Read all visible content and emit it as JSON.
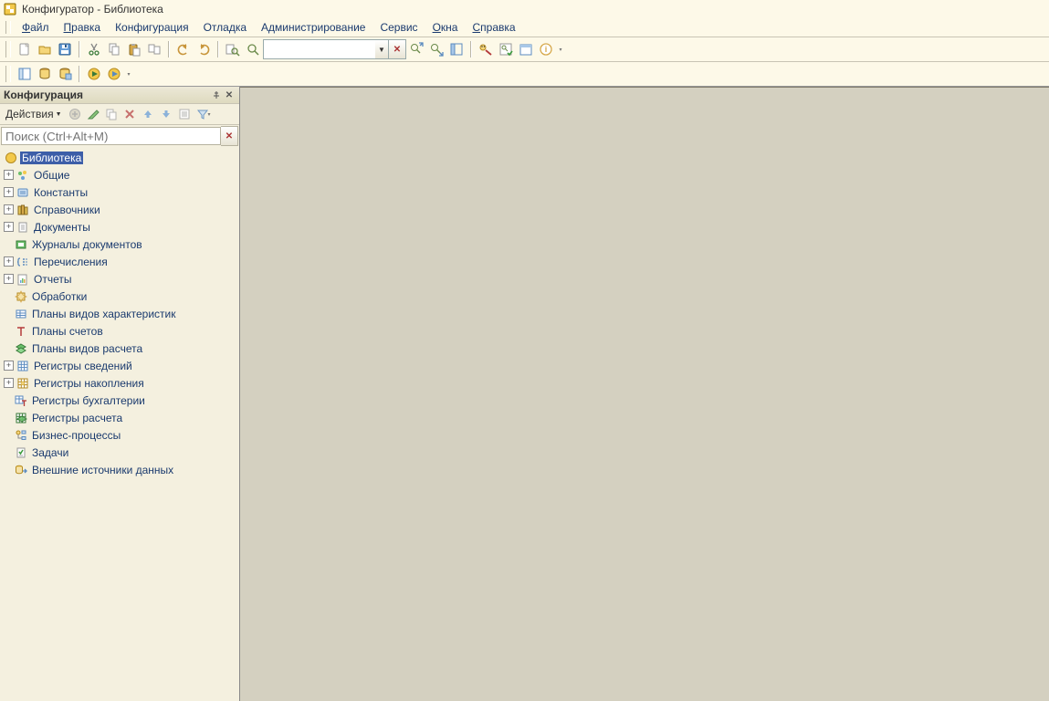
{
  "window": {
    "title": "Конфигуратор - Библиотека"
  },
  "menu": {
    "file": {
      "label": "Файл",
      "u": 0
    },
    "edit": {
      "label": "Правка",
      "u": 0
    },
    "config": {
      "label": "Конфигурация",
      "u": -1
    },
    "debug": {
      "label": "Отладка",
      "u": -1
    },
    "admin": {
      "label": "Администрирование",
      "u": -1
    },
    "service": {
      "label": "Сервис",
      "u": -1
    },
    "windows": {
      "label": "Окна",
      "u": 0
    },
    "help": {
      "label": "Справка",
      "u": 0
    }
  },
  "toolbar": {
    "searchValue": ""
  },
  "panel": {
    "title": "Конфигурация",
    "actionsLabel": "Действия",
    "searchPlaceholder": "Поиск (Ctrl+Alt+M)"
  },
  "tree": [
    {
      "id": "root",
      "label": "Библиотека",
      "icon": "circle-yellow",
      "expandable": false,
      "depth": 0,
      "selected": true
    },
    {
      "id": "common",
      "label": "Общие",
      "icon": "dots",
      "expandable": true,
      "depth": 1
    },
    {
      "id": "constants",
      "label": "Константы",
      "icon": "card-blue",
      "expandable": true,
      "depth": 1
    },
    {
      "id": "catalogs",
      "label": "Справочники",
      "icon": "books",
      "expandable": true,
      "depth": 1
    },
    {
      "id": "documents",
      "label": "Документы",
      "icon": "doc",
      "expandable": true,
      "depth": 1
    },
    {
      "id": "journals",
      "label": "Журналы документов",
      "icon": "journal",
      "expandable": false,
      "depth": 1
    },
    {
      "id": "enums",
      "label": "Перечисления",
      "icon": "list-brace",
      "expandable": true,
      "depth": 1
    },
    {
      "id": "reports",
      "label": "Отчеты",
      "icon": "report",
      "expandable": true,
      "depth": 1
    },
    {
      "id": "processing",
      "label": "Обработки",
      "icon": "processing",
      "expandable": false,
      "depth": 1
    },
    {
      "id": "pvk",
      "label": "Планы видов характеристик",
      "icon": "table",
      "expandable": false,
      "depth": 1
    },
    {
      "id": "accounts",
      "label": "Планы счетов",
      "icon": "taccount",
      "expandable": false,
      "depth": 1
    },
    {
      "id": "pvr",
      "label": "Планы видов расчета",
      "icon": "layers-green",
      "expandable": false,
      "depth": 1
    },
    {
      "id": "inforeg",
      "label": "Регистры сведений",
      "icon": "grid-blue",
      "expandable": true,
      "depth": 1
    },
    {
      "id": "accumreg",
      "label": "Регистры накопления",
      "icon": "grid-yellow",
      "expandable": true,
      "depth": 1
    },
    {
      "id": "accreg",
      "label": "Регистры бухгалтерии",
      "icon": "grid-taccount",
      "expandable": false,
      "depth": 1
    },
    {
      "id": "calcreg",
      "label": "Регистры расчета",
      "icon": "grid-green",
      "expandable": false,
      "depth": 1
    },
    {
      "id": "bp",
      "label": "Бизнес-процессы",
      "icon": "flow",
      "expandable": false,
      "depth": 1
    },
    {
      "id": "tasks",
      "label": "Задачи",
      "icon": "task",
      "expandable": false,
      "depth": 1
    },
    {
      "id": "extds",
      "label": "Внешние источники данных",
      "icon": "extdb",
      "expandable": false,
      "depth": 1
    }
  ]
}
